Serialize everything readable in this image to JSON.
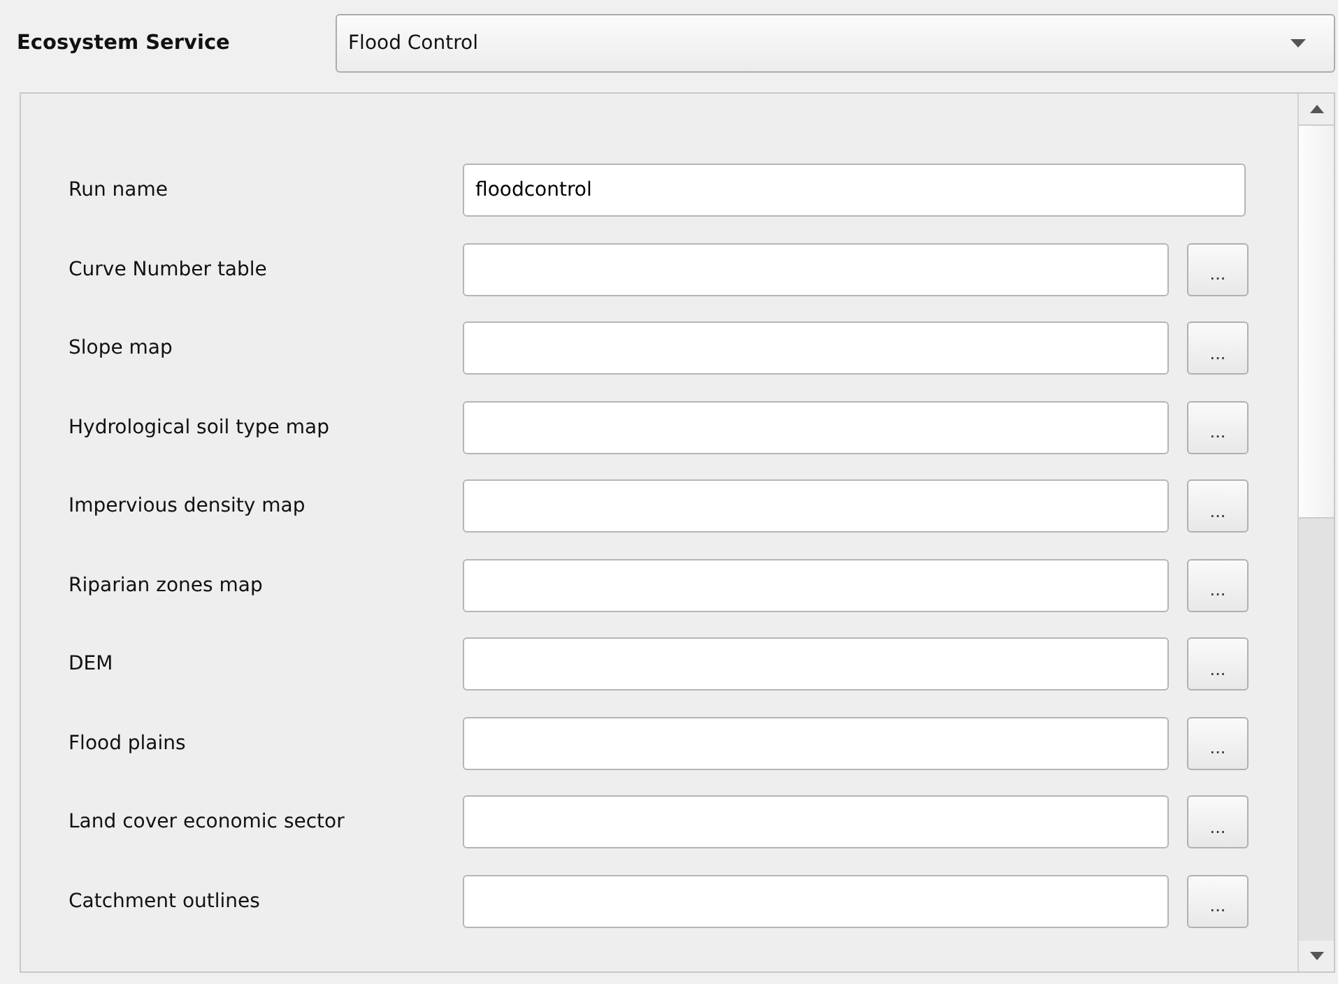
{
  "service": {
    "label": "Ecosystem Service",
    "value": "Flood Control"
  },
  "fields": [
    {
      "kind": "text",
      "label": "Run name",
      "value": "floodcontrol"
    },
    {
      "kind": "file",
      "label": "Curve Number table",
      "button": "..."
    },
    {
      "kind": "file",
      "label": "Slope map",
      "button": "..."
    },
    {
      "kind": "file",
      "label": "Hydrological soil type map",
      "button": "..."
    },
    {
      "kind": "file",
      "label": "Impervious density map",
      "button": "..."
    },
    {
      "kind": "file",
      "label": "Riparian zones map",
      "button": "..."
    },
    {
      "kind": "file",
      "label": "DEM",
      "button": "..."
    },
    {
      "kind": "file",
      "label": "Flood plains",
      "button": "..."
    },
    {
      "kind": "file",
      "label": "Land cover economic sector",
      "button": "..."
    },
    {
      "kind": "file",
      "label": "Catchment outlines",
      "button": "..."
    }
  ]
}
